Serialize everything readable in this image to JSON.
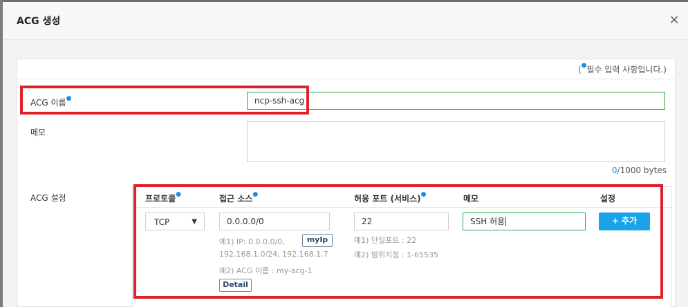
{
  "modal": {
    "title": "ACG 생성",
    "close_icon": "×"
  },
  "form": {
    "required_note_prefix": "(",
    "required_note_text": "필수 입력 사항입니다.)",
    "required_dot": "●",
    "acg_name_label": "ACG 이름",
    "acg_name_value": "ncp-ssh-acg",
    "memo_label": "메모",
    "memo_value": "",
    "byte_current": "0",
    "byte_max": "/1000 bytes",
    "acg_settings_label": "ACG 설정"
  },
  "acg_table": {
    "headers": {
      "protocol": "프로토콜",
      "source": "접근 소스",
      "port": "허용 포트 (서비스)",
      "memo": "메모",
      "setting": "설정"
    },
    "row": {
      "protocol_value": "TCP",
      "protocol_arrow": "▼",
      "source_value": "0.0.0.0/0",
      "myip_button": "myIp",
      "source_hint1_line1": "예1) IP: 0.0.0.0/0,",
      "source_hint1_line2": "192.168.1.0/24, 192.168.1.7",
      "source_hint2": "예2) ACG 이름 : my-acg-1",
      "detail_button": "Detail",
      "port_value": "22",
      "port_hint1": "예1) 단일포트 : 22",
      "port_hint2": "예2) 범위지정 : 1-65535",
      "memo_value": "SSH 허용",
      "add_button": "+ 추가"
    }
  },
  "colors": {
    "accent": "#1aa3e8",
    "highlight": "#e0202a",
    "valid_border": "#25a84b"
  }
}
